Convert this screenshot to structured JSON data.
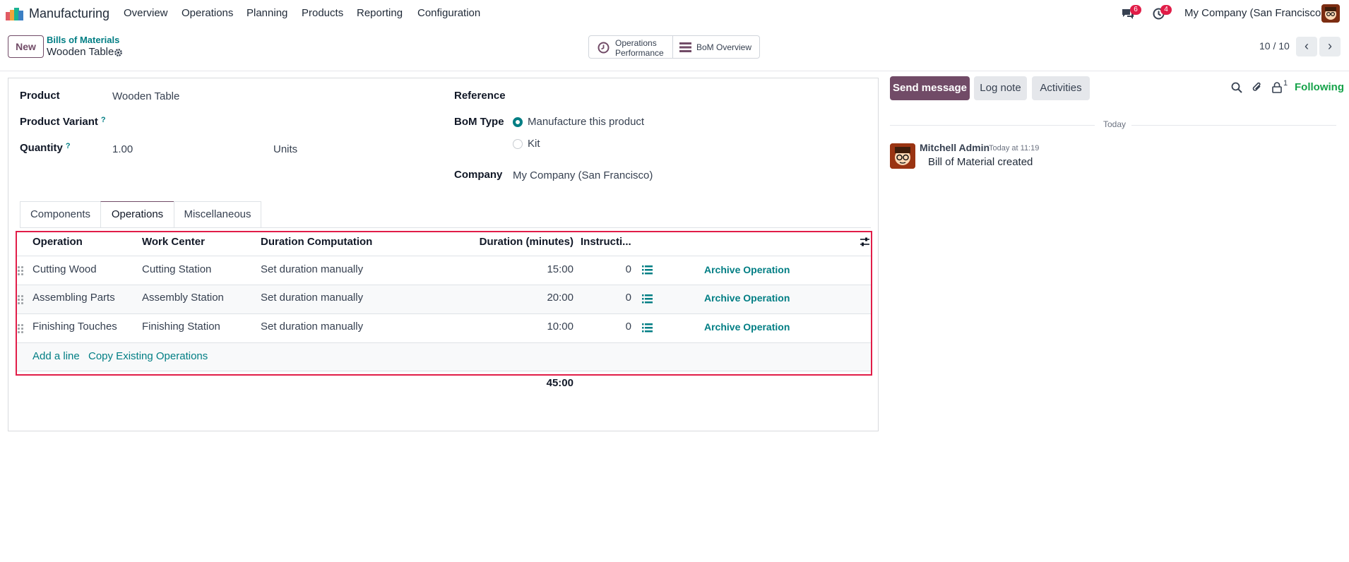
{
  "app": {
    "name": "Manufacturing",
    "menu": [
      "Overview",
      "Operations",
      "Planning",
      "Products",
      "Reporting",
      "Configuration"
    ],
    "messages_badge": "6",
    "activities_badge": "4",
    "company": "My Company (San Francisco)"
  },
  "control": {
    "new_label": "New",
    "breadcrumb": "Bills of Materials",
    "record_name": "Wooden Table",
    "smart_buttons": [
      {
        "line1": "Operations",
        "line2": "Performance",
        "icon": "clock-icon"
      },
      {
        "label": "BoM Overview",
        "icon": "bars-icon"
      }
    ],
    "pager": "10 / 10"
  },
  "form": {
    "product_label": "Product",
    "product_value": "Wooden Table",
    "variant_label": "Product Variant",
    "help_mark": "?",
    "quantity_label": "Quantity",
    "quantity_value": "1.00",
    "uom_value": "Units",
    "reference_label": "Reference",
    "bom_type_label": "BoM Type",
    "bom_type_options": [
      "Manufacture this product",
      "Kit"
    ],
    "bom_type_selected": "Manufacture this product",
    "company_label": "Company",
    "company_value": "My Company (San Francisco)"
  },
  "tabs": [
    "Components",
    "Operations",
    "Miscellaneous"
  ],
  "active_tab": "Operations",
  "operations": {
    "headers": [
      "Operation",
      "Work Center",
      "Duration Computation",
      "Duration (minutes)",
      "Instructi..."
    ],
    "rows": [
      {
        "operation": "Cutting Wood",
        "work_center": "Cutting Station",
        "computation": "Set duration manually",
        "duration": "15:00",
        "instructions": "0",
        "action": "Archive Operation"
      },
      {
        "operation": "Assembling Parts",
        "work_center": "Assembly Station",
        "computation": "Set duration manually",
        "duration": "20:00",
        "instructions": "0",
        "action": "Archive Operation"
      },
      {
        "operation": "Finishing Touches",
        "work_center": "Finishing Station",
        "computation": "Set duration manually",
        "duration": "10:00",
        "instructions": "0",
        "action": "Archive Operation"
      }
    ],
    "add_line": "Add a line",
    "copy_existing": "Copy Existing Operations",
    "total_duration": "45:00"
  },
  "chatter": {
    "send_message": "Send message",
    "log_note": "Log note",
    "activities": "Activities",
    "followers_count": "1",
    "following": "Following",
    "date_separator": "Today",
    "message": {
      "author": "Mitchell Admin",
      "time": "Today at 11:19",
      "body": "Bill of Material created"
    }
  },
  "colors": {
    "brand": "#714b67",
    "link": "#017e84",
    "badge": "#e11d48",
    "following": "#16a34a",
    "highlight_box": "#e11d48"
  }
}
